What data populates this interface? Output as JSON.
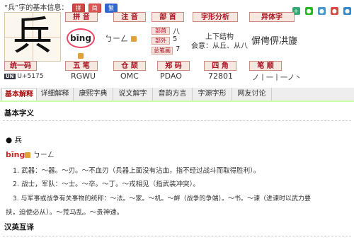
{
  "header": {
    "title": "“兵”字的基本信息：",
    "mini_badges": [
      "拼",
      "简",
      "繁"
    ],
    "share_icons": [
      "plus-icon",
      "share-green-icon",
      "share-qq-icon",
      "share-weibo-icon",
      "share-blue-icon"
    ]
  },
  "character": {
    "glyph": "兵"
  },
  "labels": {
    "pinyin": "拼 音",
    "zhuyin": "注 音",
    "bushou": "部 首",
    "zixing": "字形分析",
    "yiti": "异体字",
    "tongyi": "统一码",
    "wubi": "五 笔",
    "cangjie": "仓 颉",
    "zhengma": "郑 码",
    "sijiao": "四 角",
    "bishun": "笔 顺",
    "bushou_tag": "部首",
    "bubai_tag": "部外",
    "zongbihua_tag": "总笔画"
  },
  "values": {
    "pinyin": "bīng",
    "zhuyin": "ㄅㄧㄥ",
    "bushou": "八",
    "bubai": "5",
    "zongbihua": "7",
    "jiegou": "上下结构",
    "huiyi": "会意：从丘、从八",
    "yiti": "偋俜㑭㓋㫏",
    "unicode": "U+5175",
    "wubi": "RGWU",
    "cangjie": "OMC",
    "zhengma": "PDAO",
    "sijiao": "72801",
    "bishun": "ノ丨一丨一ノ丶"
  },
  "tabs": [
    "基本解释",
    "详细解释",
    "康熙字典",
    "说文解字",
    "音韵方言",
    "字源字形",
    "网友讨论"
  ],
  "content": {
    "section_title": "基本字义",
    "entry_char": "● 兵",
    "entry_pinyin": "bīng",
    "entry_zhuyin": "ㄅㄧㄥ",
    "defs": [
      "1.  武器：～器。～刃。～不血刃（兵器上面没有沾血，指不经过战斗而取得胜利）。",
      "2.  战士，军队：～士。～卒。～丁。～戎相见（指武装冲突）。",
      "3.  与军事或战争有关事物的统称：～法。～家。～机。～衅（战争的争端）。～书。～谏（进谏时以武力要",
      "挟，迫使必从）。～荒马乱。～贵神速。"
    ],
    "next_section": "汉英互译"
  }
}
